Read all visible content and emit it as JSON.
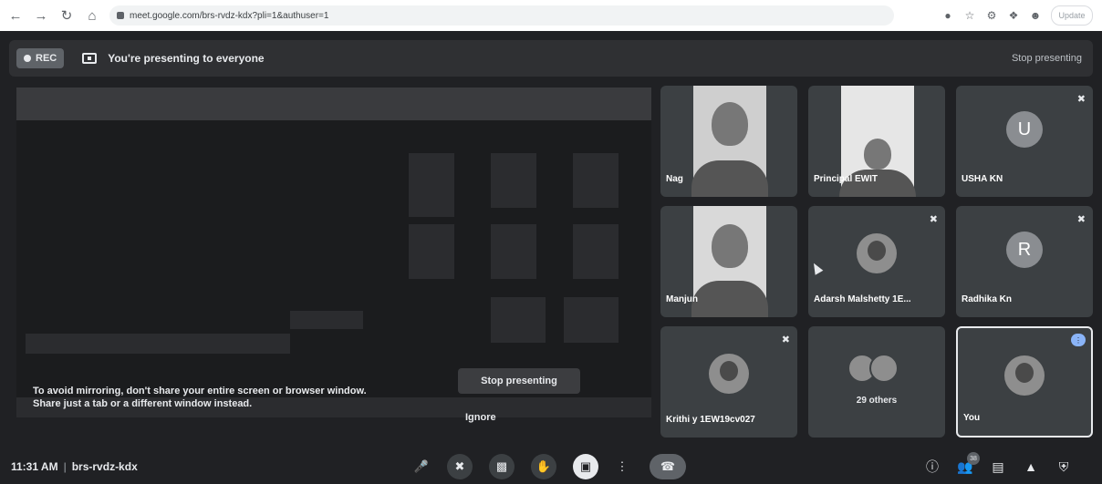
{
  "browser": {
    "url": "meet.google.com/brs-rvdz-kdx?pli=1&authuser=1",
    "update_label": "Update"
  },
  "banner": {
    "rec_label": "REC",
    "message": "You're presenting to everyone",
    "stop_label": "Stop presenting"
  },
  "screen": {
    "mirror_line1": "To avoid mirroring, don't share your entire screen or browser window.",
    "mirror_line2": "Share just a tab or a different window instead.",
    "stop_label": "Stop presenting",
    "ignore_label": "Ignore"
  },
  "tiles": [
    {
      "name": "Nag",
      "type": "video"
    },
    {
      "name": "Principal EWIT",
      "type": "video"
    },
    {
      "name": "USHA KN",
      "type": "letter",
      "letter": "U",
      "muted": true
    },
    {
      "name": "Manjun",
      "type": "video"
    },
    {
      "name": "Adarsh Malshetty 1E...",
      "type": "photo",
      "muted": true
    },
    {
      "name": "Radhika Kn",
      "type": "letter",
      "letter": "R",
      "muted": true
    },
    {
      "name": "Krithi y 1EW19cv027",
      "type": "photo",
      "muted": true
    },
    {
      "name": "29 others",
      "type": "others"
    },
    {
      "name": "You",
      "type": "photo",
      "self": true
    }
  ],
  "bottom": {
    "time": "11:31 AM",
    "meeting_code": "brs-rvdz-kdx",
    "participant_count": "38"
  }
}
